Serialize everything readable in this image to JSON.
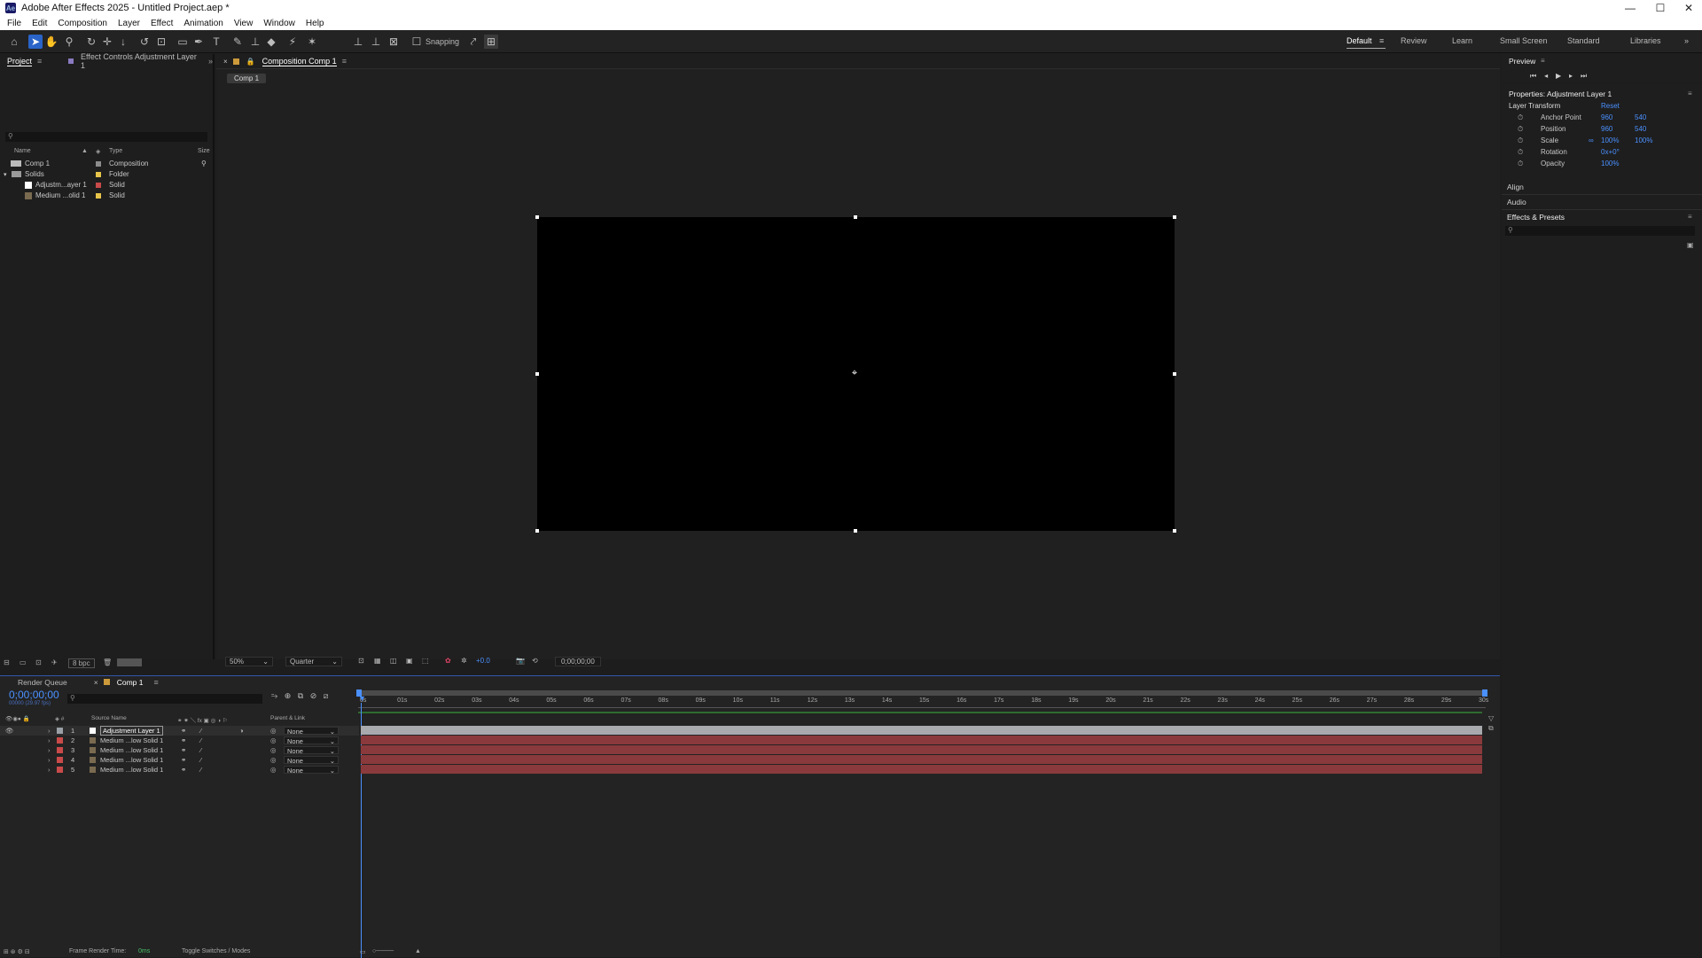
{
  "window": {
    "title": "Adobe After Effects 2025 - Untitled Project.aep *",
    "app_icon_text": "Ae"
  },
  "menu": [
    "File",
    "Edit",
    "Composition",
    "Layer",
    "Effect",
    "Animation",
    "View",
    "Window",
    "Help"
  ],
  "toolbar": {
    "snapping_label": "Snapping"
  },
  "workspaces": [
    "Default",
    "Review",
    "Learn",
    "Small Screen",
    "Standard",
    "Libraries"
  ],
  "project_panel": {
    "tabs": [
      "Project",
      "Effect Controls Adjustment Layer 1"
    ],
    "search_placeholder": "",
    "columns": {
      "name": "Name",
      "type": "Type",
      "size": "Size"
    },
    "items": [
      {
        "name": "Comp 1",
        "type": "Composition",
        "color": "#8c8c8c"
      },
      {
        "name": "Solids",
        "type": "Folder",
        "color": "#e8c54a"
      },
      {
        "name": "Adjustm...ayer 1",
        "type": "Solid",
        "color": "#c94a4a"
      },
      {
        "name": "Medium ...olid 1",
        "type": "Solid",
        "color": "#e8c54a"
      }
    ],
    "bpc": "8 bpc"
  },
  "comp_panel": {
    "tab": "Composition Comp 1",
    "breadcrumb": "Comp 1",
    "zoom": "50%",
    "resolution": "Quarter",
    "exposure": "+0.0",
    "timecode": "0;00;00;00"
  },
  "preview_panel": {
    "title": "Preview"
  },
  "properties_panel": {
    "title": "Properties: Adjustment Layer 1",
    "section": "Layer Transform",
    "reset": "Reset",
    "props": [
      {
        "name": "Anchor Point",
        "v1": "960",
        "v2": "540"
      },
      {
        "name": "Position",
        "v1": "960",
        "v2": "540"
      },
      {
        "name": "Scale",
        "v1": "100%",
        "v2": "100%"
      },
      {
        "name": "Rotation",
        "v1": "0x+0°",
        "v2": ""
      },
      {
        "name": "Opacity",
        "v1": "100%",
        "v2": ""
      }
    ],
    "align": "Align",
    "audio": "Audio",
    "effects_presets": "Effects & Presets"
  },
  "timeline": {
    "tabs": [
      "Render Queue",
      "Comp 1"
    ],
    "timecode": "0;00;00;00",
    "fps": "00000 (29.97 fps)",
    "columns": {
      "source": "Source Name",
      "parent": "Parent & Link"
    },
    "ticks": [
      "0s",
      "01s",
      "02s",
      "03s",
      "04s",
      "05s",
      "06s",
      "07s",
      "08s",
      "09s",
      "10s",
      "11s",
      "12s",
      "13s",
      "14s",
      "15s",
      "16s",
      "17s",
      "18s",
      "19s",
      "20s",
      "21s",
      "22s",
      "23s",
      "24s",
      "25s",
      "26s",
      "27s",
      "28s",
      "29s",
      "30s"
    ],
    "layers": [
      {
        "num": "1",
        "name": "Adjustment Layer 1",
        "parent": "None",
        "color": "#9aa0a6",
        "bar": "#a8aaae"
      },
      {
        "num": "2",
        "name": "Medium ...low Solid 1",
        "parent": "None",
        "color": "#c94a4a",
        "bar": "#8a3a3c"
      },
      {
        "num": "3",
        "name": "Medium ...low Solid 1",
        "parent": "None",
        "color": "#c94a4a",
        "bar": "#8a3a3c"
      },
      {
        "num": "4",
        "name": "Medium ...low Solid 1",
        "parent": "None",
        "color": "#c94a4a",
        "bar": "#8a3a3c"
      },
      {
        "num": "5",
        "name": "Medium ...low Solid 1",
        "parent": "None",
        "color": "#c94a4a",
        "bar": "#8a3a3c"
      }
    ],
    "footer": {
      "render_label": "Frame Render Time:",
      "render_value": "0ms",
      "toggle": "Toggle Switches / Modes"
    }
  }
}
